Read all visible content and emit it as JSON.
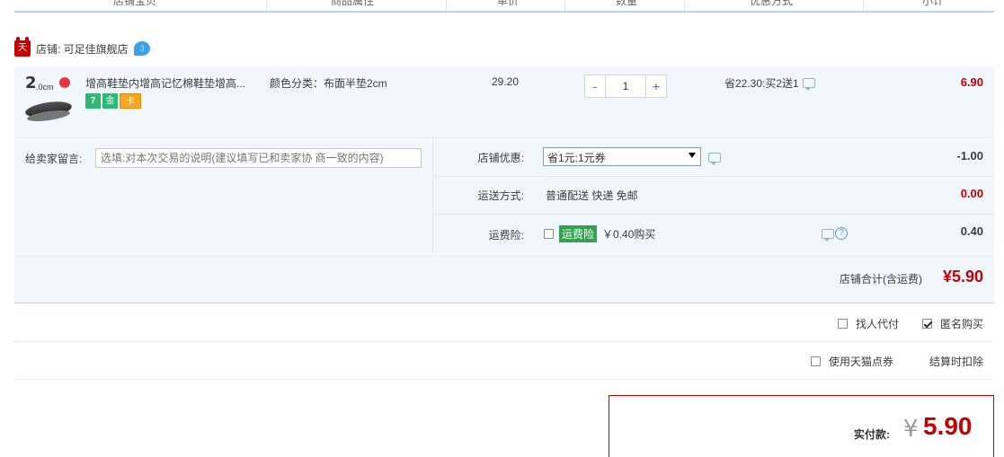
{
  "header": {
    "columns": [
      "店铺宝贝",
      "商品属性",
      "单价",
      "数量",
      "优惠方式",
      "小计"
    ]
  },
  "shop": {
    "badge": "天猫",
    "name": "店铺: 可足佳旗舰店",
    "ww_icon": "bubble-icon"
  },
  "item": {
    "thumb_size": "2.0cm",
    "thumb_big": "2",
    "thumb_small": ".0cm",
    "title": "增高鞋垫内增高记忆棉鞋垫增高...",
    "icons": [
      "7",
      "金",
      "卡"
    ],
    "sku": "颜色分类：布面半垫2cm",
    "price": "29.20",
    "qty_minus": "-",
    "qty_value": "1",
    "qty_plus": "+",
    "promo": "省22.30:买2送1",
    "total": "6.90"
  },
  "message": {
    "label": "给卖家留言:",
    "placeholder": "选填:对本次交易的说明(建议填写已和卖家协 商一致的内容)"
  },
  "services": {
    "coupon_label": "店铺优惠:",
    "coupon_value": "省1元:1元券",
    "coupon_amount": "-1.00",
    "shipping_label": "运送方式:",
    "shipping_value": "普通配送 快递 免邮",
    "shipping_amount": "0.00",
    "insurance_label": "运费险:",
    "insurance_tag": "运费险",
    "insurance_text": "￥0.40购买",
    "insurance_amount": "0.40"
  },
  "shop_total": {
    "label": "店铺合计(含运费)",
    "amount": "¥5.90"
  },
  "options": {
    "proxy_pay": "找人代付",
    "anonymous": "匿名购买",
    "tmall_points": "使用天猫点券",
    "deduct_note": "结算时扣除"
  },
  "payment": {
    "label": "实付款:",
    "yen": "¥",
    "amount": "5.90"
  },
  "colors": {
    "accent_red": "#c40000",
    "row_bg": "#f2f7ff",
    "header_line": "#b2d1ff"
  }
}
